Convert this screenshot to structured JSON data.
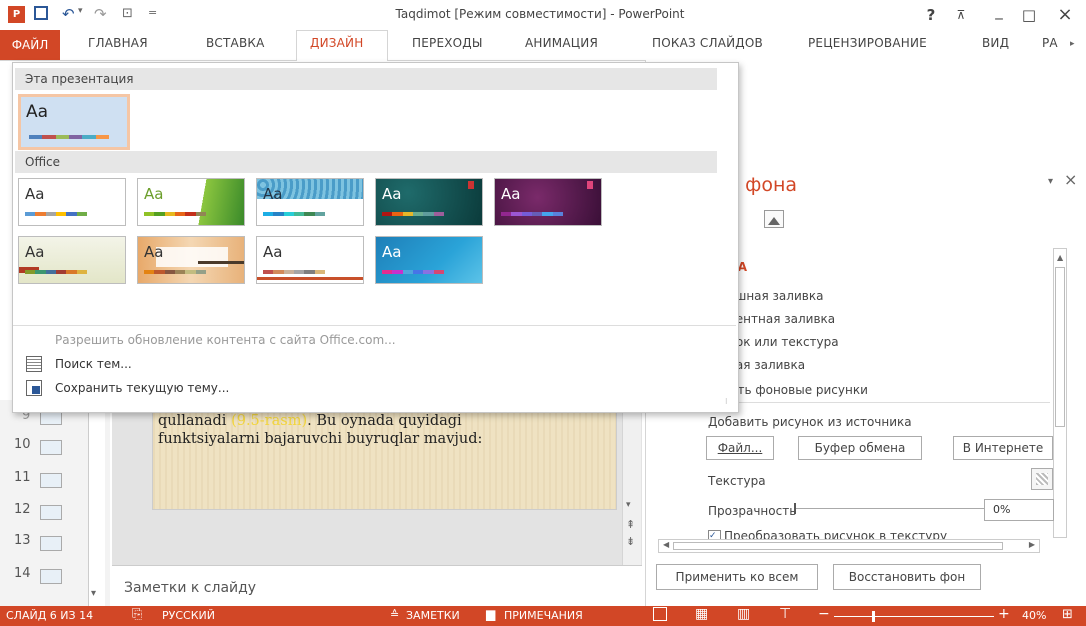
{
  "window": {
    "title": "Taqdimot [Режим совместимости] - PowerPoint",
    "help": "?",
    "buttons": [
      "_",
      "□",
      "×"
    ]
  },
  "tabs": [
    "ФАЙЛ",
    "ГЛАВНАЯ",
    "ВСТАВКА",
    "ДИЗАЙН",
    "ПЕРЕХОДЫ",
    "АНИМАЦИЯ",
    "ПОКАЗ СЛАЙДОВ",
    "РЕЦЕНЗИРОВАНИЕ",
    "ВИД",
    "РА"
  ],
  "active_tab": "ДИЗАЙН",
  "dropdown": {
    "section_this": "Эта презентация",
    "section_office": "Office",
    "theme_text": "Aa",
    "menu": {
      "allow_update": "Разрешить обновление контента с сайта Office.com...",
      "browse": "Поиск тем...",
      "save": "Сохранить текущую тему..."
    }
  },
  "slides": [
    "9",
    "10",
    "11",
    "12",
    "13",
    "14"
  ],
  "slide_text": {
    "line1_a": "qullanadi ",
    "line1_hl": "(9.5-rasm)",
    "line1_b": ". Bu oynada quyidagi",
    "line2": "funktsiyalarni bajaruvchi buyruqlar mavjud:"
  },
  "notes_placeholder": "Заметки к слайду",
  "pane": {
    "title": "т фона",
    "section": "КА",
    "options": [
      "ошная заливка",
      "иентная заливка",
      "нок или текстура",
      "ная заливка",
      "ыть фоновые рисунки"
    ],
    "insert_from": "Добавить рисунок из источника",
    "btn_file": "Файл...",
    "btn_clipboard": "Буфер обмена",
    "btn_internet": "В Интернете",
    "texture_label": "Текстура",
    "transparency_label": "Прозрачность",
    "transparency_value": "0%",
    "tile_label": "Преобразовать рисунок в текстуру",
    "apply_all": "Применить ко всем",
    "reset": "Восстановить фон"
  },
  "status": {
    "slide": "СЛАЙД 6 ИЗ 14",
    "lang": "РУССКИЙ",
    "notes": "ЗАМЕТКИ",
    "comments": "ПРИМЕЧАНИЯ",
    "zoom": "40%"
  },
  "colors": {
    "accent": "#d24726",
    "selection": "#f5c6a5"
  }
}
